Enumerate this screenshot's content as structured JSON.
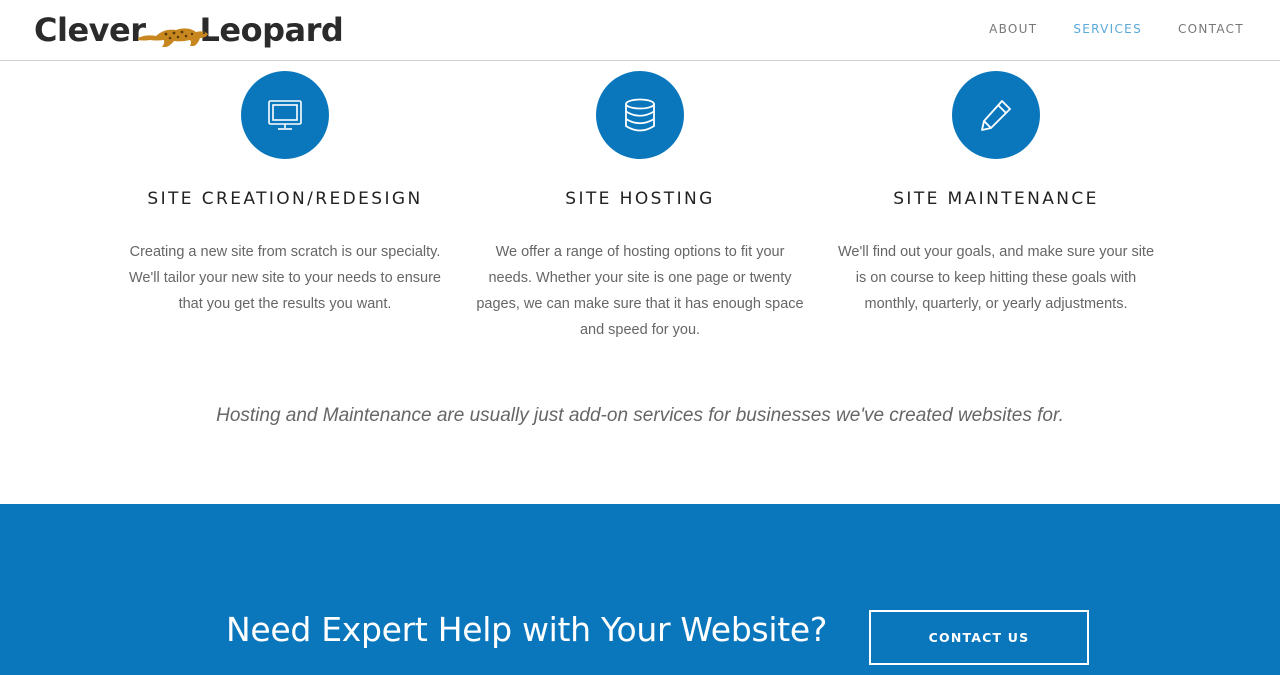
{
  "brand": {
    "logo_part1": "Clever",
    "logo_part2": "Leopard"
  },
  "nav": {
    "items": [
      {
        "label": "ABOUT"
      },
      {
        "label": "SERVICES",
        "active": true
      },
      {
        "label": "CONTACT"
      }
    ]
  },
  "services": [
    {
      "icon": "monitor-icon",
      "title": "SITE CREATION/REDESIGN",
      "description": "Creating a new site from scratch is our specialty. We'll tailor your new site to your needs to ensure that you get the results you want."
    },
    {
      "icon": "database-icon",
      "title": "SITE HOSTING",
      "description": "We offer a range of hosting options to fit your needs. Whether your site is one page or twenty pages, we can make sure that it has enough space and speed for you."
    },
    {
      "icon": "pencil-icon",
      "title": "SITE MAINTENANCE",
      "description": "We'll find out your goals, and make sure your site is on course to keep hitting these goals with monthly, quarterly, or yearly adjustments."
    }
  ],
  "note": "Hosting and Maintenance are usually just add-on services for businesses we've created websites for.",
  "cta": {
    "heading": "Need Expert Help with Your Website?",
    "button_label": "CONTACT US"
  },
  "colors": {
    "accent": "#0a77bd",
    "nav_active": "#5aa9da",
    "text": "#666666"
  }
}
